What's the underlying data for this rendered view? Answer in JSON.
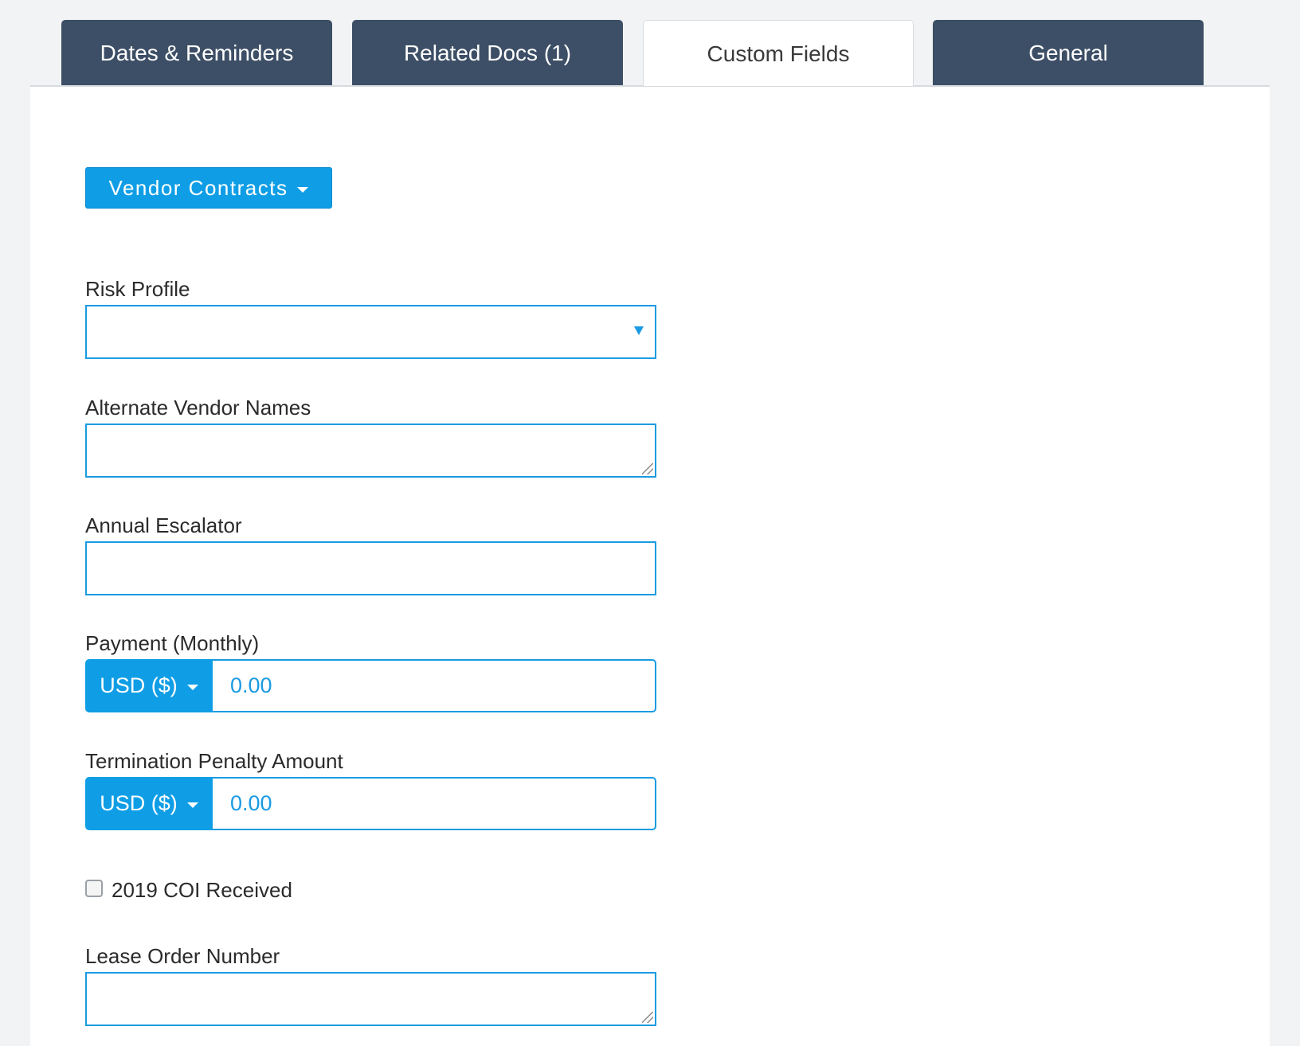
{
  "tabs": [
    {
      "label": "Dates & Reminders",
      "active": false
    },
    {
      "label": "Related Docs (1)",
      "active": false
    },
    {
      "label": "Custom Fields",
      "active": true
    },
    {
      "label": "General",
      "active": false
    }
  ],
  "group_selector": {
    "label": "Vendor Contracts"
  },
  "fields": {
    "risk_profile": {
      "label": "Risk Profile",
      "value": ""
    },
    "alternate_vendor_names": {
      "label": "Alternate Vendor Names",
      "value": ""
    },
    "annual_escalator": {
      "label": "Annual Escalator",
      "value": ""
    },
    "payment_monthly": {
      "label": "Payment (Monthly)",
      "currency": "USD ($)",
      "value": "0.00"
    },
    "termination_penalty": {
      "label": "Termination Penalty Amount",
      "currency": "USD ($)",
      "value": "0.00"
    },
    "coi_received": {
      "label": "2019 COI Received",
      "checked": false
    },
    "lease_order_number": {
      "label": "Lease Order Number",
      "value": ""
    }
  },
  "colors": {
    "accent": "#0f9ee6",
    "tab_dark": "#3d4f66",
    "border": "#1a9be2"
  }
}
